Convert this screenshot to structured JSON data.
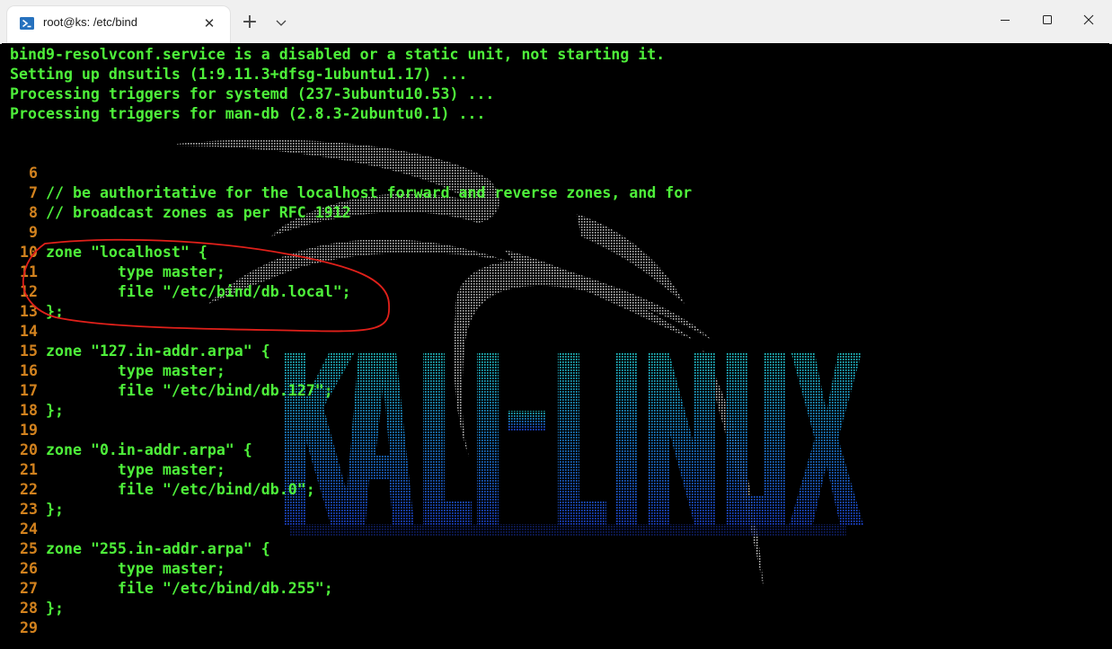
{
  "window": {
    "tab_title": "root@ks: /etc/bind",
    "tab_icon": "powershell-icon",
    "new_tab_label": "+",
    "dropdown_label": "⌄",
    "close_tab_label": "✕"
  },
  "terminal": {
    "output_lines": [
      "bind9-resolvconf.service is a disabled or a static unit, not starting it.",
      "Setting up dnsutils (1:9.11.3+dfsg-1ubuntu1.17) ...",
      "Processing triggers for systemd (237-3ubuntu10.53) ...",
      "Processing triggers for man-db (2.8.3-2ubuntu0.1) ..."
    ],
    "code_lines": [
      {
        "num": "6",
        "text": ""
      },
      {
        "num": "7",
        "text": "// be authoritative for the localhost forward and reverse zones, and for"
      },
      {
        "num": "8",
        "text": "// broadcast zones as per RFC 1912"
      },
      {
        "num": "9",
        "text": ""
      },
      {
        "num": "10",
        "text": "zone \"localhost\" {"
      },
      {
        "num": "11",
        "text": "        type master;"
      },
      {
        "num": "12",
        "text": "        file \"/etc/bind/db.local\";"
      },
      {
        "num": "13",
        "text": "};"
      },
      {
        "num": "14",
        "text": ""
      },
      {
        "num": "15",
        "text": "zone \"127.in-addr.arpa\" {"
      },
      {
        "num": "16",
        "text": "        type master;"
      },
      {
        "num": "17",
        "text": "        file \"/etc/bind/db.127\";"
      },
      {
        "num": "18",
        "text": "};"
      },
      {
        "num": "19",
        "text": ""
      },
      {
        "num": "20",
        "text": "zone \"0.in-addr.arpa\" {"
      },
      {
        "num": "21",
        "text": "        type master;"
      },
      {
        "num": "22",
        "text": "        file \"/etc/bind/db.0\";"
      },
      {
        "num": "23",
        "text": "};"
      },
      {
        "num": "24",
        "text": ""
      },
      {
        "num": "25",
        "text": "zone \"255.in-addr.arpa\" {"
      },
      {
        "num": "26",
        "text": "        type master;"
      },
      {
        "num": "27",
        "text": "        file \"/etc/bind/db.255\";"
      },
      {
        "num": "28",
        "text": "};"
      },
      {
        "num": "29",
        "text": ""
      }
    ]
  },
  "background": {
    "logo_text": "KALI LINUX"
  },
  "colors": {
    "output_text": "#4ef03a",
    "code_text": "#4ef03a",
    "line_number": "#d2821e",
    "annotation": "#e0201a",
    "logo_teal": "#1ea8b8",
    "logo_blue": "#1e4cc8"
  }
}
